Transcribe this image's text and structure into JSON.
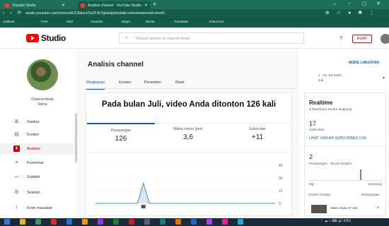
{
  "browser": {
    "tabs": [
      {
        "title": "Youtube Studio",
        "favicon_color": "#ff3333"
      },
      {
        "title": "Analisis channel - YouTube Studio",
        "favicon_color": "#ff3333"
      }
    ],
    "new_tab": "+",
    "window_controls": [
      "⌄",
      "–",
      "▢",
      "✕"
    ],
    "nav_buttons": "‹ › ⟳",
    "url": "studio.youtube.com/channel/UC3alvcxSxZFJkYg/analytics/tab-overview/period-month",
    "extensions": "⊕ ☆ ● ✱ ⋮",
    "bookmarks": [
      "Aplikasi",
      "Free",
      "Mail",
      "Youtube",
      "Maps",
      "Berita",
      "Translate",
      "Dokumen"
    ]
  },
  "header": {
    "logo_text": "Studio",
    "search_placeholder": "Telusuri konten di channel Anda",
    "help_icon": "?",
    "create_label": "BUAT"
  },
  "sidebar": {
    "channel_name": "Channel Anda",
    "channel_sub": "Nama",
    "items": [
      {
        "label": "Dasbor",
        "icon": "⊞"
      },
      {
        "label": "Konten",
        "icon": "▤"
      },
      {
        "label": "Analisis",
        "icon": "▮"
      },
      {
        "label": "Komentar",
        "icon": "≡"
      },
      {
        "label": "Subtitel",
        "icon": "▭"
      },
      {
        "label": "Setelan",
        "icon": "⚙"
      },
      {
        "label": "Kirim masukan",
        "icon": "!"
      }
    ]
  },
  "main": {
    "title": "Analisis channel",
    "tabs": [
      "Ringkasan",
      "Konten",
      "Penonton",
      "Riset"
    ],
    "headline": "Pada bulan Juli, video Anda ditonton 126 kali",
    "metrics": [
      {
        "label": "Penayangan",
        "value": "126"
      },
      {
        "label": "Waktu tonton (jam)",
        "value": "3,6"
      },
      {
        "label": "Subscriber",
        "value": "+11"
      }
    ]
  },
  "right": {
    "advanced_mode": "MODE LANJUTAN",
    "date_line1": "1 - 31 Juli 2023",
    "date_line2": "Juli",
    "realtime_title": "Realtime",
    "realtime_sub": "● Diperbarui secara langsung",
    "subs_value": "17",
    "subs_label": "Subscriber",
    "see_subs": "LIHAT JUMLAH SUBSCRIBER LIVE",
    "views_value": "2",
    "views_label": "Penayangan · 48 jam terakhir",
    "spark_left": "48j",
    "spark_right": "Sekarang",
    "top_left": "Konten teratas",
    "top_right": "Penayangan",
    "video_title": "Video Anda 17 Juli",
    "video_value": "2"
  },
  "chart_data": {
    "type": "area",
    "series": [
      {
        "values": [
          0,
          0,
          0,
          0,
          0,
          0,
          0,
          0,
          24,
          0,
          0,
          0,
          0,
          0,
          0,
          0,
          0,
          0,
          0,
          0,
          0,
          0,
          0,
          0,
          0,
          0,
          0,
          0,
          0,
          0,
          0
        ]
      }
    ],
    "y_ticks": [
      "45",
      "30",
      "15",
      "0"
    ],
    "ylim": [
      0,
      45
    ],
    "color": "#4a90d9",
    "fill": "#d6e6f7"
  },
  "taskbar": {
    "icons": [
      "#3a7bd5",
      "#e6b422",
      "#2aa160",
      "#d93025",
      "#1a73e8",
      "#f29900",
      "#9334e6",
      "#188038",
      "#c5221f",
      "#5f6368",
      "#00897b",
      "#e37400",
      "#1967d2",
      "#a142f4",
      "#e52592",
      "#12b5cb"
    ],
    "tray": "⌃ ☁ ◐ ⌨ 🔊 ENG"
  }
}
